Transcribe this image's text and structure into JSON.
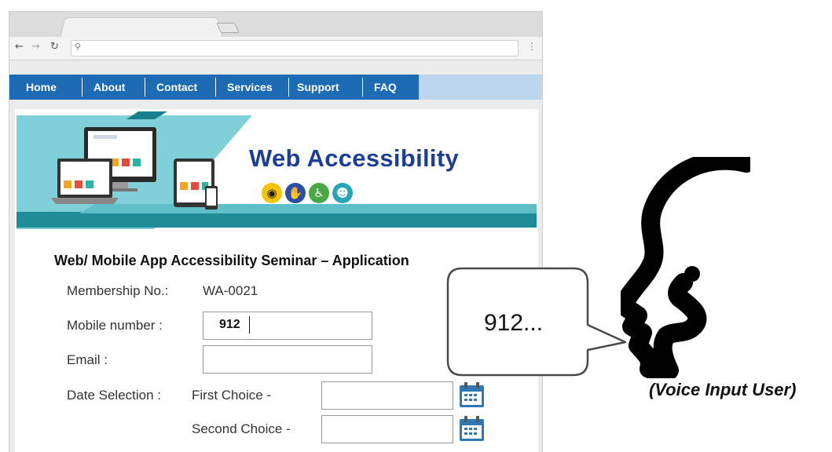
{
  "navbar": {
    "items": [
      "Home",
      "About",
      "Contact",
      "Services",
      "Support",
      "FAQ"
    ]
  },
  "banner": {
    "title": "Web Accessibility",
    "icons": [
      "eye-icon",
      "sign-language-icon",
      "wheelchair-icon",
      "head-cognition-icon"
    ]
  },
  "form": {
    "title": "Web/ Mobile App Accessibility Seminar – Application",
    "membership_label": "Membership No.:",
    "membership_value": "WA-0021",
    "mobile_label": "Mobile number :",
    "mobile_value": "912",
    "email_label": "Email :",
    "email_value": "",
    "date_label": "Date Selection :",
    "first_choice_label": "First Choice -",
    "first_choice_value": "",
    "second_choice_label": "Second Choice -",
    "second_choice_value": ""
  },
  "speech": {
    "text": "912..."
  },
  "speaker": {
    "label": "(Voice Input User)"
  },
  "colors": {
    "nav_blue": "#1d6bb5",
    "nav_light": "#bcd6ee",
    "banner_teal": "#7fd0d8",
    "title_navy": "#1c3f93"
  }
}
